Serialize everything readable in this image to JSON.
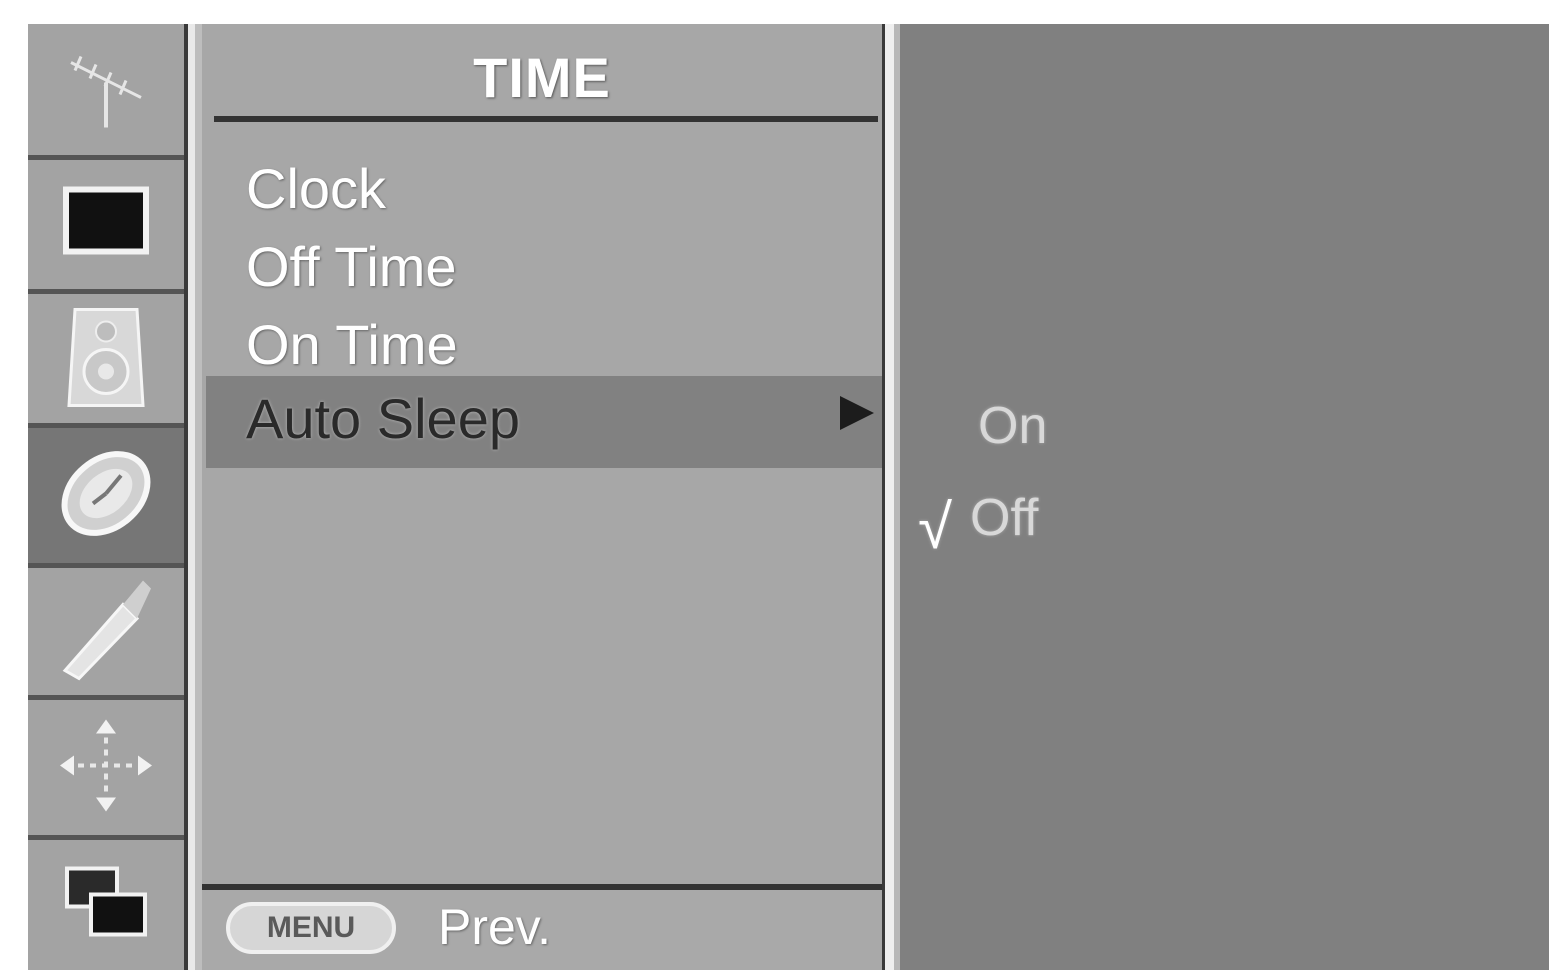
{
  "sidebar": {
    "items": [
      {
        "icon": "antenna-icon",
        "selected": false
      },
      {
        "icon": "picture-icon",
        "selected": false
      },
      {
        "icon": "speaker-icon",
        "selected": false
      },
      {
        "icon": "clock-icon",
        "selected": true
      },
      {
        "icon": "wrench-icon",
        "selected": false
      },
      {
        "icon": "psm-icon",
        "selected": false
      },
      {
        "icon": "pip-icon",
        "selected": false
      }
    ]
  },
  "menu": {
    "title": "TIME",
    "items": [
      {
        "label": "Clock"
      },
      {
        "label": "Off Time"
      },
      {
        "label": "On Time"
      },
      {
        "label": "Auto Sleep",
        "highlighted": true
      }
    ]
  },
  "submenu": {
    "options": [
      {
        "label": "On",
        "checked": false
      },
      {
        "label": "Off",
        "checked": true
      }
    ],
    "check_mark": "√"
  },
  "footer": {
    "menu_key_label": "MENU",
    "prev_label": "Prev."
  },
  "colors": {
    "panel": "#a7a7a7",
    "highlight": "#818181",
    "submenu_bg": "#808080",
    "text": "#ffffff"
  }
}
